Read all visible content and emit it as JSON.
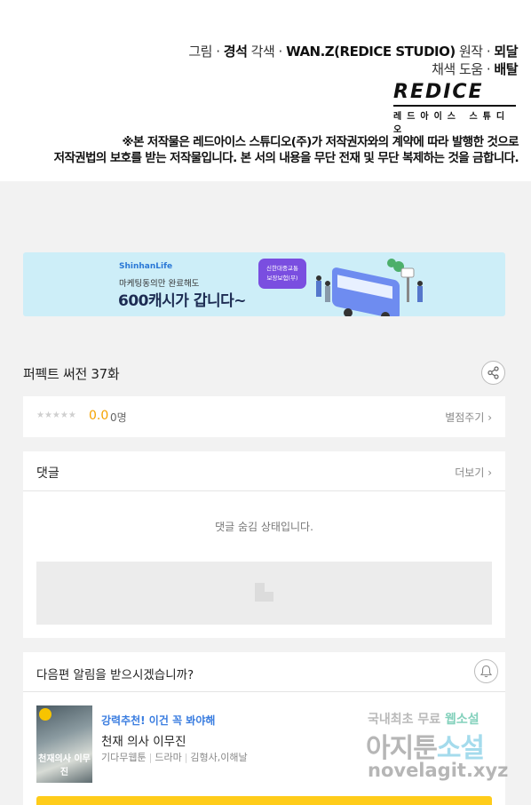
{
  "credits": {
    "line1_prefix": "그림 · ",
    "line1_artist": "경석",
    "line1_mid": "  각색 · ",
    "line1_adapt": "WAN.Z(REDICE STUDIO)",
    "line1_orig_label": "  원작 · ",
    "line1_orig": "뫼달",
    "line2_prefix": "채색 도움 · ",
    "line2_name": "배탈",
    "logo_word": "REDICE",
    "logo_sub": "레드아이스 스튜디오",
    "notice_1": "※본 저작물은 레드아이스 스튜디오(주)가 저작권자와의 계약에 따라 발행한 것으로",
    "notice_2": "저작권법의 보호를 받는 저작물입니다. 본 서의 내용을 무단 전재 및 무단 복제하는 것을 금합니다."
  },
  "ad": {
    "brand": "ShinhanLife",
    "sub": "마케팅동의만 완료해도",
    "main": "600캐시가 갑니다~",
    "badge_1": "신한대중교통",
    "badge_2": "보장보험(무)"
  },
  "episode": {
    "title": "퍼펙트 써전 37화"
  },
  "rating": {
    "stars": "★★★★★",
    "score": "0.0",
    "count": "0명",
    "rate_button": "별점주기 ›"
  },
  "comments": {
    "title": "댓글",
    "more_button": "더보기 ›",
    "hidden_message": "댓글 숨김 상태입니다."
  },
  "next": {
    "question": "다음편 알림을 받으시겠습니까?",
    "reco_tag": "강력추천! 이건 꼭 봐야해",
    "reco_title": "천재 의사 이무진",
    "reco_genre": "기다무웹툰",
    "reco_category": "드라마",
    "reco_authors": "김형사,이해날",
    "thumb_text": "천재의사 이무진"
  },
  "watermark": {
    "line1_a": "국내최초 무료 ",
    "line1_b": "웹소설",
    "line2_a": "아지툰",
    "line2_b": "소설",
    "line3": "novelagit.xyz"
  }
}
